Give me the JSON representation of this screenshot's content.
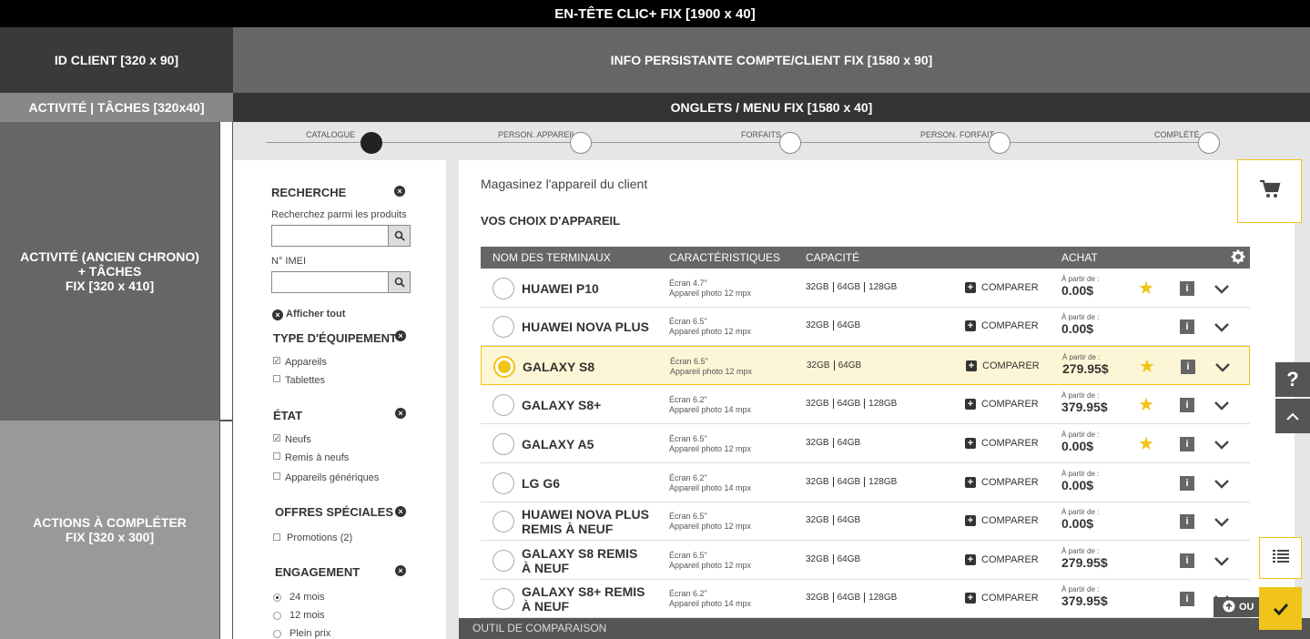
{
  "header": {
    "title": "EN-TÊTE CLIC+ FIX  [1900 x 40]",
    "id_client": "ID CLIENT [320 x 90]",
    "persistent_info": "INFO PERSISTANTE COMPTE/CLIENT FIX [1580 x 90]",
    "activity_tab": "ACTIVITÉ  |  TÂCHES [320x40]",
    "tabs_menu": "ONGLETS / MENU FIX [1580 x 40]"
  },
  "left_panels": {
    "activity_line1": "ACTIVITÉ (ANCIEN CHRONO)",
    "activity_line2": "+ TÂCHES",
    "activity_line3": "FIX [320 x 410]",
    "actions_line1": "ACTIONS À COMPLÉTER",
    "actions_line2": "FIX [320 x 300]"
  },
  "stepper": {
    "steps": [
      {
        "label": "CATALOGUE",
        "active": true
      },
      {
        "label": "PERSON. APPAREIL",
        "active": false
      },
      {
        "label": "FORFAITS",
        "active": false
      },
      {
        "label": "PERSON. FORFAIT",
        "active": false
      },
      {
        "label": "COMPLÉTÉ",
        "active": false
      }
    ]
  },
  "filters": {
    "search_title": "RECHERCHE",
    "search_hint": "Recherchez parmi les produits",
    "imei_label": "N° IMEI",
    "show_all": "Afficher tout",
    "equipment_title": "TYPE D'ÉQUIPEMENT",
    "equipment_options": [
      {
        "label": "Appareils",
        "checked": true
      },
      {
        "label": "Tablettes",
        "checked": false
      }
    ],
    "state_title": "ÉTAT",
    "state_options": [
      {
        "label": "Neufs",
        "checked": true
      },
      {
        "label": "Remis à neufs",
        "checked": false
      },
      {
        "label": "Appareils génériques",
        "checked": false
      }
    ],
    "offers_title": "OFFRES SPÉCIALES",
    "offers_options": [
      {
        "label": "Promotions (2)",
        "checked": false
      }
    ],
    "engagement_title": "ENGAGEMENT",
    "engagement_options": [
      {
        "label": "24 mois",
        "selected": true
      },
      {
        "label": "12 mois",
        "selected": false
      },
      {
        "label": "Plein prix",
        "selected": false
      }
    ]
  },
  "main": {
    "title": "Magasinez l'appareil du client",
    "subtitle": "VOS CHOIX D'APPAREIL",
    "columns": {
      "name": "NOM DES TERMINAUX",
      "features": "CARACTÉRISTIQUES",
      "capacity": "CAPACITÉ",
      "purchase": "ACHAT"
    },
    "compare_label": "COMPARER",
    "from_label": "À partir de :",
    "rows": [
      {
        "name1": "HUAWEI P10",
        "name2": "",
        "screen": "Écran 4.7\"",
        "camera": "Appareil photo 12 mpx",
        "caps": [
          "32GB",
          "64GB",
          "128GB"
        ],
        "price": "0.00$",
        "star": true,
        "selected": false
      },
      {
        "name1": "HUAWEI NOVA PLUS",
        "name2": "",
        "screen": "Écran 6.5\"",
        "camera": "Appareil photo 12 mpx",
        "caps": [
          "32GB",
          "64GB"
        ],
        "price": "0.00$",
        "star": false,
        "selected": false
      },
      {
        "name1": "GALAXY S8",
        "name2": "",
        "screen": "Écran 6.5\"",
        "camera": "Appareil photo 12 mpx",
        "caps": [
          "32GB",
          "64GB"
        ],
        "price": "279.95$",
        "star": true,
        "selected": true
      },
      {
        "name1": "GALAXY S8+",
        "name2": "",
        "screen": "Écran 6.2\"",
        "camera": "Appareil photo 14 mpx",
        "caps": [
          "32GB",
          "64GB",
          "128GB"
        ],
        "price": "379.95$",
        "star": true,
        "selected": false
      },
      {
        "name1": "GALAXY A5",
        "name2": "",
        "screen": "Écran 6.5\"",
        "camera": "Appareil photo 12 mpx",
        "caps": [
          "32GB",
          "64GB"
        ],
        "price": "0.00$",
        "star": true,
        "selected": false
      },
      {
        "name1": "LG G6",
        "name2": "",
        "screen": "Écran 6.2\"",
        "camera": "Appareil photo 14 mpx",
        "caps": [
          "32GB",
          "64GB",
          "128GB"
        ],
        "price": "0.00$",
        "star": false,
        "selected": false
      },
      {
        "name1": "HUAWEI NOVA PLUS",
        "name2": "REMIS À NEUF",
        "screen": "Écran 6.5\"",
        "camera": "Appareil photo 12 mpx",
        "caps": [
          "32GB",
          "64GB"
        ],
        "price": "0.00$",
        "star": false,
        "selected": false
      },
      {
        "name1": "GALAXY S8 REMIS",
        "name2": "À NEUF",
        "screen": "Écran 6.5\"",
        "camera": "Appareil photo 12 mpx",
        "caps": [
          "32GB",
          "64GB"
        ],
        "price": "279.95$",
        "star": false,
        "selected": false
      },
      {
        "name1": "GALAXY S8+ REMIS",
        "name2": "À NEUF",
        "screen": "Écran 6.2\"",
        "camera": "Appareil photo 14 mpx",
        "caps": [
          "32GB",
          "64GB",
          "128GB"
        ],
        "price": "379.95$",
        "star": false,
        "selected": false
      }
    ],
    "compare_tool": "OUTIL DE COMPARAISON"
  },
  "floating": {
    "ou_label": "OU"
  },
  "colors": {
    "accent": "#f0c419",
    "header_bg": "#000000",
    "panel_dark": "#333333"
  }
}
